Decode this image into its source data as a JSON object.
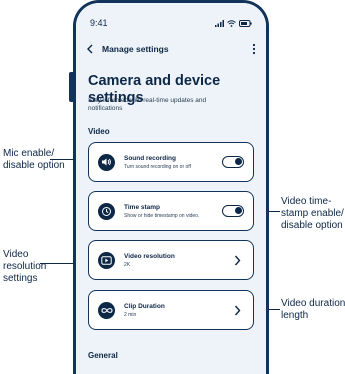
{
  "annotations": {
    "mic": "Mic enable/\ndisable option",
    "timestamp": "Video time-\nstamp enable/\ndisable option",
    "resolution": "Video\nresolution\nsettings",
    "duration": "Video duration\nlength"
  },
  "status": {
    "time": "9:41"
  },
  "nav": {
    "title": "Manage settings"
  },
  "page": {
    "title": "Camera and device settings",
    "subtitle": "Stay informed with real-time updates and notifications"
  },
  "sections": {
    "video": "Video",
    "general": "General"
  },
  "cards": [
    {
      "title": "Sound recording",
      "subtitle": "Turn sound recording on or off",
      "control": "toggle",
      "enabled": true,
      "icon": "speaker-icon"
    },
    {
      "title": "Time stamp",
      "subtitle": "Show or hide timestamp on video.",
      "control": "toggle",
      "enabled": true,
      "icon": "clock-icon"
    },
    {
      "title": "Video resolution",
      "subtitle": "2K",
      "control": "chevron",
      "icon": "play-icon"
    },
    {
      "title": "Clip Duration",
      "subtitle": "2 min",
      "control": "chevron",
      "icon": "infinity-icon"
    }
  ],
  "colors": {
    "primary": "#0d2747",
    "screen_bg": "#edf3f8",
    "card_bg": "#ffffff"
  }
}
